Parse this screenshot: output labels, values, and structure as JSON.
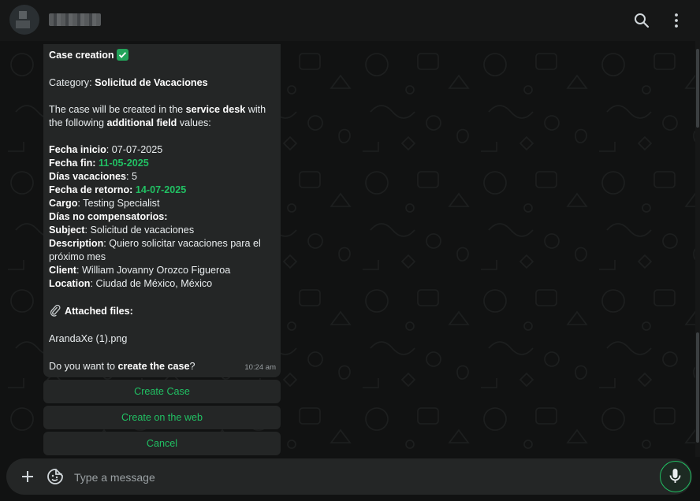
{
  "header": {
    "icons": [
      "search-icon",
      "menu-icon"
    ]
  },
  "message": {
    "title": "Case creation",
    "category_prefix": "Category: ",
    "category_value": "Solicitud de Vacaciones",
    "intro_part1": "The case will be created in the ",
    "intro_bold1": "service desk",
    "intro_part2": " with",
    "intro_part3": "the following ",
    "intro_bold2": "additional field",
    "intro_part4": " values:",
    "fields": [
      {
        "label": "Fecha inicio",
        "value": ": 07-07-2025"
      },
      {
        "label": "Fecha fin",
        "value": "11-05-2025"
      },
      {
        "label": "Días vacaciones",
        "value": ": 5"
      },
      {
        "label": "Fecha de retorno",
        "value": "14-07-2025"
      },
      {
        "label": "Cargo",
        "value": ": Testing Specialist"
      },
      {
        "label": "Días no compensatorios",
        "value": ":"
      },
      {
        "label": "Subject",
        "value": ": Solicitud de vacaciones"
      },
      {
        "label": "Description",
        "value": ": Quiero solicitar vacaciones para el"
      },
      {
        "label": "",
        "value": "próximo mes"
      },
      {
        "label": "Client",
        "value": ": William Jovanny Orozco Figueroa"
      },
      {
        "label": "Location",
        "value": ": Ciudad de México, México"
      }
    ],
    "attached_label": "Attached files:",
    "attachment": "ArandaXe (1).png",
    "question_part1": "Do you want to ",
    "question_bold": "create the case",
    "question_part2": "?",
    "time": "10:24 am"
  },
  "actions": {
    "create_case": "Create Case",
    "create_web": "Create on the web",
    "cancel": "Cancel"
  },
  "composer": {
    "placeholder": "Type a message"
  },
  "colors": {
    "accent": "#21c063",
    "bubble": "#242626",
    "background": "#111212"
  }
}
